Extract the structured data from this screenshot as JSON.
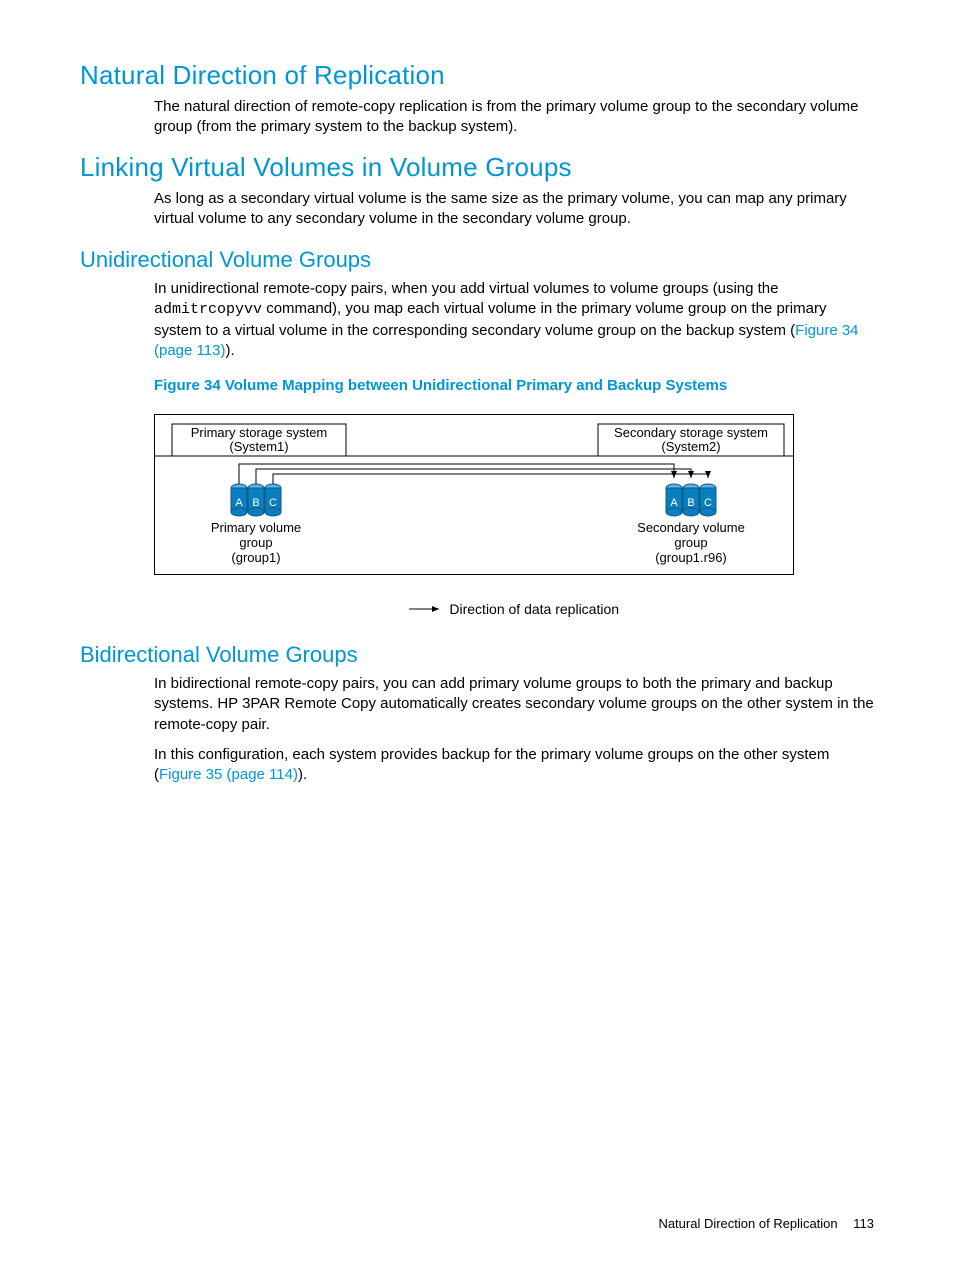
{
  "sections": {
    "s1": {
      "title": "Natural Direction of Replication",
      "p1": "The natural direction of remote-copy replication is from the primary volume group to the secondary volume group (from the primary system to the backup system)."
    },
    "s2": {
      "title": "Linking Virtual Volumes in Volume Groups",
      "p1": "As long as a secondary virtual volume is the same size as the primary volume, you can map any primary virtual volume to any secondary volume in the secondary volume group."
    },
    "s3": {
      "title": "Unidirectional Volume Groups",
      "p1a": "In unidirectional remote-copy pairs, when you add virtual volumes to volume groups (using the ",
      "code": "admitrcopyvv",
      "p1b": " command), you map each virtual volume in the primary volume group on the primary system to a virtual volume in the corresponding secondary volume group on the backup system (",
      "xref": "Figure 34 (page 113)",
      "p1c": ").",
      "figcap": "Figure 34 Volume Mapping between Unidirectional Primary and Backup Systems"
    },
    "figure": {
      "left_box_l1": "Primary storage system",
      "left_box_l2": "(System1)",
      "right_box_l1": "Secondary storage system",
      "right_box_l2": "(System2)",
      "vol_a": "A",
      "vol_b": "B",
      "vol_c": "C",
      "left_cap_l1": "Primary volume",
      "left_cap_l2": "group",
      "left_cap_l3": "(group1)",
      "right_cap_l1": "Secondary volume",
      "right_cap_l2": "group",
      "right_cap_l3": "(group1.r96)",
      "legend": "Direction of data replication"
    },
    "s4": {
      "title": "Bidirectional Volume Groups",
      "p1": "In bidirectional remote-copy pairs, you can add primary volume groups to both the primary and backup systems. HP 3PAR Remote Copy automatically creates secondary volume groups on the other system in the remote-copy pair.",
      "p2a": "In this configuration, each system provides backup for the primary volume groups on the other system (",
      "xref": "Figure 35 (page 114)",
      "p2b": ")."
    }
  },
  "footer": {
    "title": "Natural Direction of Replication",
    "page": "113"
  }
}
